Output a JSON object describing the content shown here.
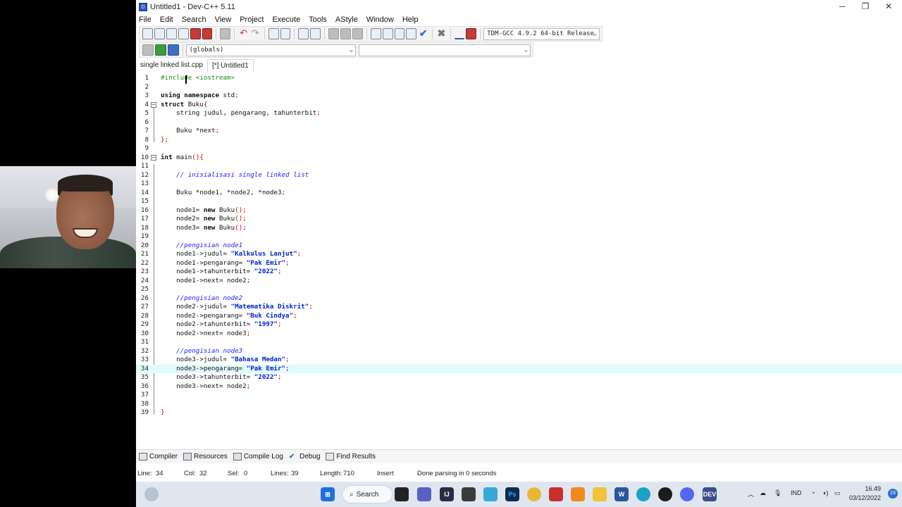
{
  "window": {
    "title": "Untitled1 - Dev-C++ 5.11",
    "minimize": "─",
    "restore": "❐",
    "close": "✕"
  },
  "menu": [
    "File",
    "Edit",
    "Search",
    "View",
    "Project",
    "Execute",
    "Tools",
    "AStyle",
    "Window",
    "Help"
  ],
  "toolbar": {
    "compiler_select": "TDM-GCC 4.9.2 64-bit Release",
    "globals_select": "(globals)",
    "function_select": ""
  },
  "tabs": [
    {
      "label": "single linked list.cpp",
      "active": false
    },
    {
      "label": "[*] Untitled1",
      "active": true
    }
  ],
  "editor": {
    "current_line": 34,
    "lines": [
      "#include <iostream>",
      "",
      "using namespace std;",
      "struct Buku{",
      "    string judul, pengarang, tahunterbit;",
      "",
      "    Buku *next;",
      "};",
      "",
      "int main(){",
      "",
      "    // inisialisasi single linked list",
      "",
      "    Buku *node1, *node2, *node3;",
      "",
      "    node1= new Buku();",
      "    node2= new Buku();",
      "    node3= new Buku();",
      "",
      "    //pengisian node1",
      "    node1->judul= \"Kalkulus Lanjut\";",
      "    node1->pengarang= \"Pak Emir\";",
      "    node1->tahunterbit= \"2022\";",
      "    node1->next= node2;",
      "",
      "    //pengisian node2",
      "    node2->judul= \"Matematika Diskrit\";",
      "    node2->pengarang= \"Buk Cindya\";",
      "    node2->tahunterbit= \"1997\";",
      "    node2->next= node3;",
      "",
      "    //pengisian node3",
      "    node3->judul= \"Bahasa Medan\";",
      "    node3->pengarang= \"Pak Emir\";",
      "    node3->tahunterbit= \"2022\";",
      "    node3->next= node2;",
      "",
      "",
      "}"
    ]
  },
  "bottom_tabs": [
    {
      "label": "Compiler",
      "icon": "compiler-icon"
    },
    {
      "label": "Resources",
      "icon": "resources-icon"
    },
    {
      "label": "Compile Log",
      "icon": "compile-log-icon"
    },
    {
      "label": "Debug",
      "icon": "debug-icon"
    },
    {
      "label": "Find Results",
      "icon": "find-results-icon"
    }
  ],
  "status": {
    "line_label": "Line:",
    "line_value": "34",
    "col_label": "Col:",
    "col_value": "32",
    "sel_label": "Sel:",
    "sel_value": "0",
    "lines_label": "Lines:",
    "lines_value": "39",
    "length_label": "Length:",
    "length_value": "710",
    "mode": "Insert",
    "message": "Done parsing in 0 seconds"
  },
  "taskbar": {
    "search_label": "Search",
    "language": "IND",
    "time": "16.49",
    "date": "03/12/2022",
    "notification_count": "23"
  },
  "colors": {
    "current_line": "#e0fbfb",
    "preprocessor": "#1c8a1c",
    "comment": "#2020ff",
    "string": "#0020d0",
    "symbol": "#cc0000",
    "taskbar": "#dfe6f0"
  }
}
